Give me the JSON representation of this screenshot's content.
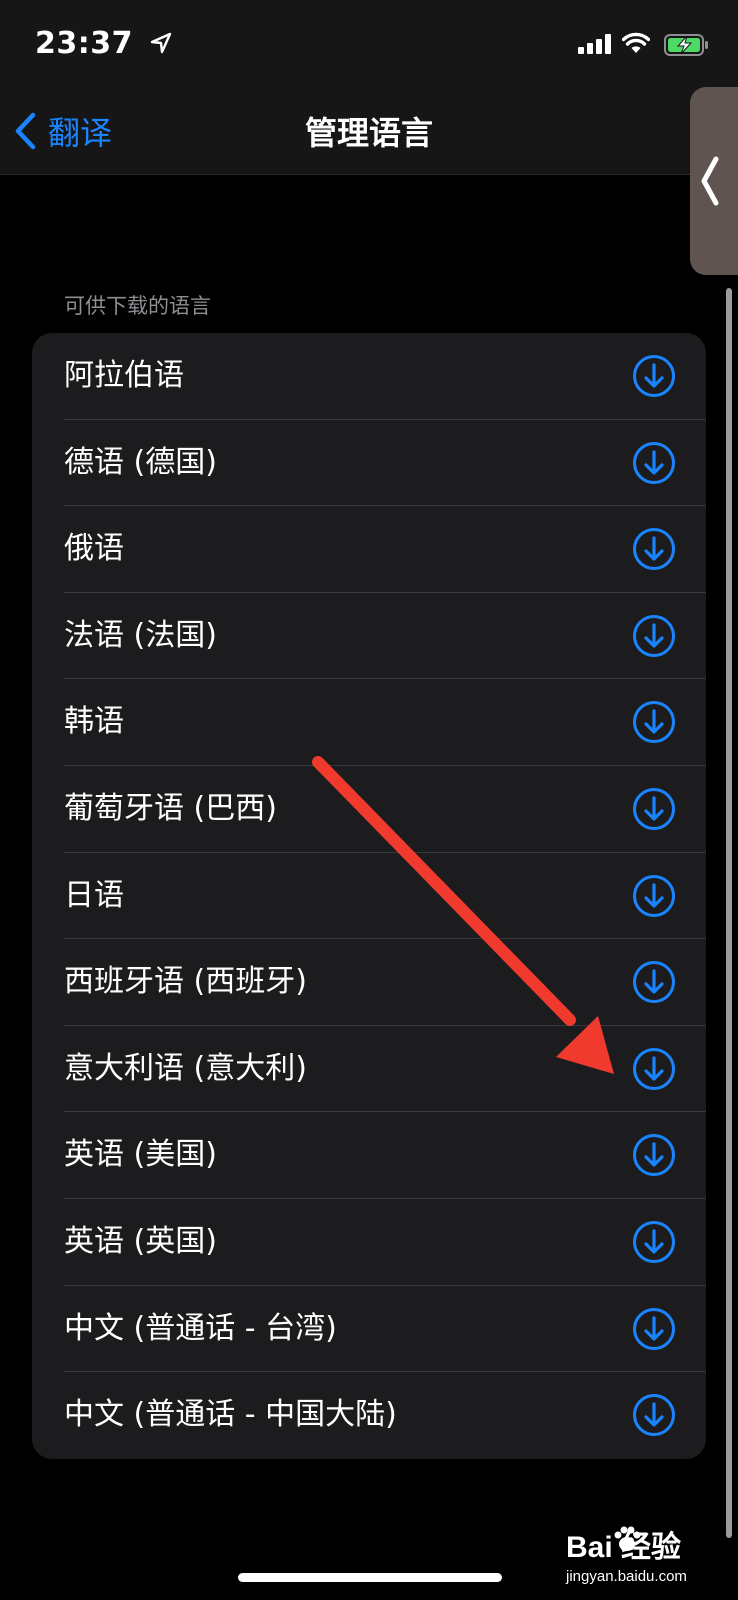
{
  "status_bar": {
    "time": "23:37",
    "icons": [
      "location-arrow-icon",
      "cellular-signal-icon",
      "wifi-icon",
      "battery-charging-icon"
    ],
    "battery_color": "#4cd964"
  },
  "nav": {
    "back_label": "翻译",
    "title": "管理语言",
    "accent_color": "#1a84ff"
  },
  "section": {
    "header": "可供下载的语言"
  },
  "languages": [
    {
      "name": "阿拉伯语"
    },
    {
      "name": "德语 (德国)"
    },
    {
      "name": "俄语"
    },
    {
      "name": "法语 (法国)"
    },
    {
      "name": "韩语"
    },
    {
      "name": "葡萄牙语 (巴西)"
    },
    {
      "name": "日语"
    },
    {
      "name": "西班牙语 (西班牙)"
    },
    {
      "name": "意大利语 (意大利)"
    },
    {
      "name": "英语 (美国)"
    },
    {
      "name": "英语 (英国)"
    },
    {
      "name": "中文 (普通话 - 台湾)"
    },
    {
      "name": "中文 (普通话 - 中国大陆)"
    }
  ],
  "annotation": {
    "arrow_color": "#f03a2e"
  },
  "watermark": {
    "logo": "Bai  经验",
    "site": "jingyan.baidu.com"
  }
}
